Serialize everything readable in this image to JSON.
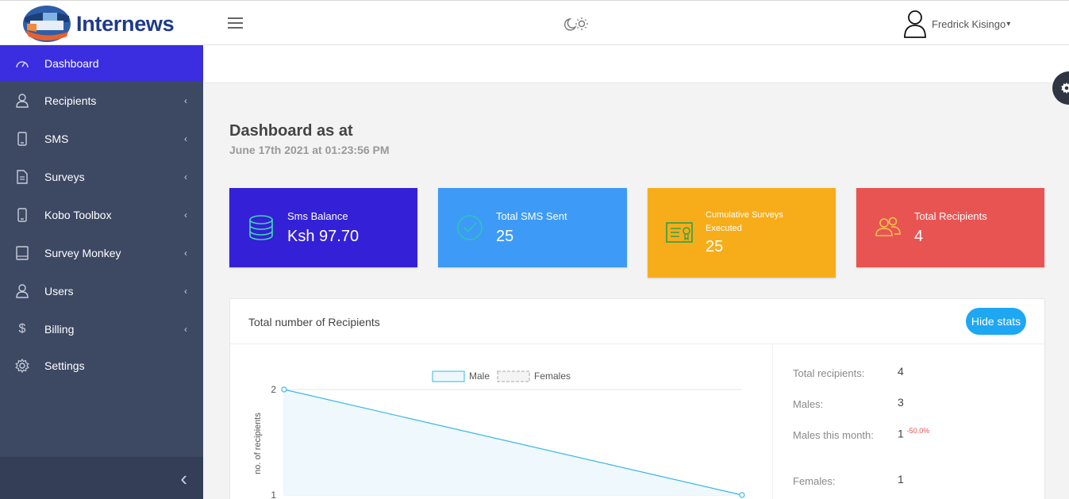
{
  "brand": {
    "name": "Internews"
  },
  "user": {
    "name": "Fredrick Kisingo",
    "caret": "⌄"
  },
  "sidebar": {
    "items": [
      {
        "label": "Dashboard",
        "icon": "gauge-icon",
        "arrow": ""
      },
      {
        "label": "Recipients",
        "icon": "person-icon",
        "arrow": "‹"
      },
      {
        "label": "SMS",
        "icon": "phone-icon",
        "arrow": "‹"
      },
      {
        "label": "Surveys",
        "icon": "document-icon",
        "arrow": "‹"
      },
      {
        "label": "Kobo Toolbox",
        "icon": "phone-icon",
        "arrow": "‹"
      },
      {
        "label": "Survey Monkey",
        "icon": "book-icon",
        "arrow": "‹"
      },
      {
        "label": "Users",
        "icon": "person-icon",
        "arrow": "‹"
      },
      {
        "label": "Billing",
        "icon": "dollar-icon",
        "arrow": "‹"
      },
      {
        "label": "Settings",
        "icon": "gear-icon",
        "arrow": ""
      }
    ],
    "collapse": "‹"
  },
  "page": {
    "title": "Dashboard as at",
    "subtitle": "June 17th 2021 at  01:23:56 PM"
  },
  "cards": [
    {
      "label": "Sms Balance",
      "value": "Ksh 97.70",
      "color": "#3420d6",
      "icon": "database-icon"
    },
    {
      "label": "Total SMS Sent",
      "value": "25",
      "color": "#3d9bf7",
      "icon": "check-circle-icon"
    },
    {
      "label": "Cumulative Surveys Executed",
      "value": "25",
      "color": "#f7ad1a",
      "icon": "certificate-icon"
    },
    {
      "label": "Total Recipients",
      "value": "4",
      "color": "#e85452",
      "icon": "users-icon"
    }
  ],
  "panel": {
    "title": "Total number of Recipients",
    "hide_label": "Hide stats"
  },
  "stats": [
    {
      "key": "Total recipients:",
      "value": "4",
      "delta": ""
    },
    {
      "key": "Males:",
      "value": "3",
      "delta": ""
    },
    {
      "key": "Males this month:",
      "value": "1",
      "delta": "-50.0%"
    },
    {
      "key": "Females:",
      "value": "1",
      "delta": ""
    }
  ],
  "chart_data": {
    "type": "line",
    "ylabel": "no. of recipients",
    "series": [
      {
        "name": "Male",
        "values": [
          2,
          1
        ]
      },
      {
        "name": "Females",
        "values": []
      }
    ],
    "y_ticks": [
      "2",
      "1"
    ],
    "ylim": [
      1,
      2
    ],
    "colors": {
      "Male": "#3ab6e6"
    },
    "legend": "top"
  }
}
